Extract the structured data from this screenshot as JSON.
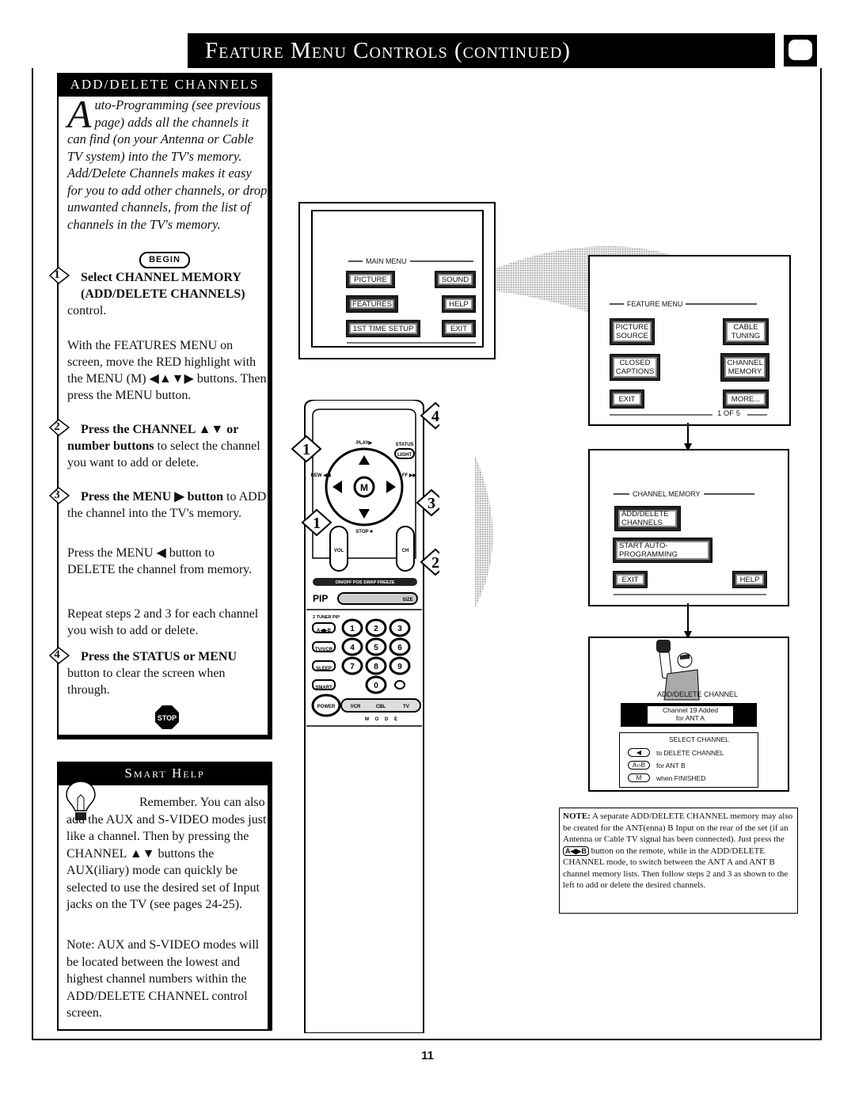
{
  "header": {
    "title": "Feature Menu Controls (continued)",
    "icon": "tv-screen-icon"
  },
  "add_delete": {
    "heading": "ADD/DELETE CHANNELS",
    "intro_dropcap": "A",
    "intro_rest": "uto-Programming (see previous page) adds all the channels it can find (on your Antenna or Cable TV system) into the TV's memory. Add/Delete Channels makes it easy for you to add other channels, or drop unwanted channels, from the list of channels in the TV's memory.",
    "begin_label": "BEGIN",
    "steps": [
      {
        "number": "1",
        "bold": "Select CHANNEL MEMORY (ADD/DELETE CHANNELS)",
        "text": "control.",
        "detail": "With the FEATURES MENU on screen, move the RED highlight with the MENU (M) ◀▲▼▶ buttons. Then press the MENU button."
      },
      {
        "number": "2",
        "bold": "Press the CHANNEL ▲▼ or number buttons",
        "text": "to select the channel you want to add or delete."
      },
      {
        "number": "3",
        "bold": "Press the MENU ▶ button",
        "text": "to ADD the channel into the TV's memory.",
        "detail": "Press the MENU ◀ button to DELETE the channel from memory.",
        "detail2": "Repeat steps 2 and 3 for each channel you wish to add or delete."
      },
      {
        "number": "4",
        "bold": "Press the STATUS or MENU",
        "text": "button to clear the screen when through."
      }
    ],
    "stop_label": "STOP"
  },
  "smart_help": {
    "heading": "Smart Help",
    "para1": "Remember. You can also add the AUX and S-VIDEO modes just like a channel. Then by pressing the CHANNEL ▲▼ buttons the AUX(iliary) mode can quickly be selected to use the desired set of Input jacks on the TV (see pages 24-25).",
    "para2": "Note: AUX and S-VIDEO modes will be located between the lowest and highest channel numbers within the ADD/DELETE CHANNEL control screen."
  },
  "main_menu": {
    "title": "MAIN MENU",
    "buttons": [
      "PICTURE",
      "SOUND",
      "FEATURES",
      "HELP",
      "1ST TIME SETUP",
      "EXIT"
    ],
    "highlighted": "FEATURES"
  },
  "feature_menu": {
    "title": "FEATURE MENU",
    "buttons": [
      "PICTURE SOURCE",
      "CABLE TUNING",
      "CLOSED CAPTIONS",
      "CHANNEL MEMORY",
      "EXIT",
      "MORE..."
    ],
    "highlighted": "CHANNEL MEMORY",
    "page": "1 OF 5"
  },
  "channel_memory_menu": {
    "title": "CHANNEL MEMORY",
    "buttons": [
      "ADD/DELETE CHANNELS",
      "START AUTO-PROGRAMMING",
      "EXIT",
      "HELP"
    ],
    "highlighted": "ADD/DELETE CHANNELS"
  },
  "add_delete_screen": {
    "title": "ADD/DELETE CHANNEL",
    "status_line1": "Channel 19 Added",
    "status_line2": "for ANT A",
    "select_label": "SELECT CHANNEL",
    "hints": [
      {
        "key": "◀",
        "text": "to DELETE CHANNEL"
      },
      {
        "key": "A‹›B",
        "text": "for ANT B"
      },
      {
        "key": "M",
        "text": "when FINISHED"
      }
    ]
  },
  "remote": {
    "labels": {
      "play": "PLAY▶",
      "status": "STATUS",
      "light": "LIGHT",
      "rew": "REW ◀◀",
      "ff": "FF ▶▶",
      "stop": "STOP ■",
      "menu": "M",
      "vol": "VOL",
      "ch": "CH",
      "pip_row": [
        "ON/OFF",
        "POS",
        "SWAP",
        "FREEZE"
      ],
      "pip": "PIP",
      "size": "SIZE",
      "tuner_pip": "2 TUNER PIP",
      "ab": "A◀▶B",
      "tvvcr": "TV/VCR",
      "sleep": "SLEEP",
      "smart": "SMART",
      "power": "POWER",
      "modes": [
        "VCR",
        "CBL",
        "TV"
      ],
      "mode": "M O D E"
    },
    "digits": [
      "1",
      "2",
      "3",
      "4",
      "5",
      "6",
      "7",
      "8",
      "9",
      "0"
    ],
    "callouts": [
      "1",
      "1",
      "2",
      "3",
      "4"
    ]
  },
  "note": {
    "bold": "NOTE:",
    "text_a": "A separate ADD/DELETE CHANNEL memory may also be created for the ANT(enna) B Input on the rear of the set (if an Antenna or Cable TV signal has been connected). Just press the",
    "button": "A◀▶B",
    "text_b": "button on the remote, while in the ADD/DELETE CHANNEL mode, to switch between the ANT A and ANT B channel memory lists. Then follow steps 2 and 3 as shown to the left to add or delete the desired channels."
  },
  "page_number": "11"
}
